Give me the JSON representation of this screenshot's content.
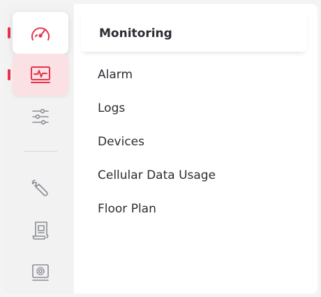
{
  "rail": {
    "items": [
      {
        "icon": "speedometer-icon",
        "state": "marked"
      },
      {
        "icon": "monitor-pulse-icon",
        "state": "active"
      },
      {
        "icon": "sliders-icon",
        "state": "normal"
      },
      {
        "icon": "wrench-icon",
        "state": "normal"
      },
      {
        "icon": "scroll-document-icon",
        "state": "normal"
      },
      {
        "icon": "monitor-gear-icon",
        "state": "normal"
      }
    ]
  },
  "panel": {
    "title": "Monitoring",
    "items": [
      {
        "label": "Alarm"
      },
      {
        "label": "Logs"
      },
      {
        "label": "Devices"
      },
      {
        "label": "Cellular Data Usage"
      },
      {
        "label": "Floor Plan"
      }
    ]
  },
  "colors": {
    "accent": "#e5334a",
    "active_bg": "#fbe1e3",
    "icon_gray": "#8b8d93",
    "text": "#2b2d33"
  }
}
